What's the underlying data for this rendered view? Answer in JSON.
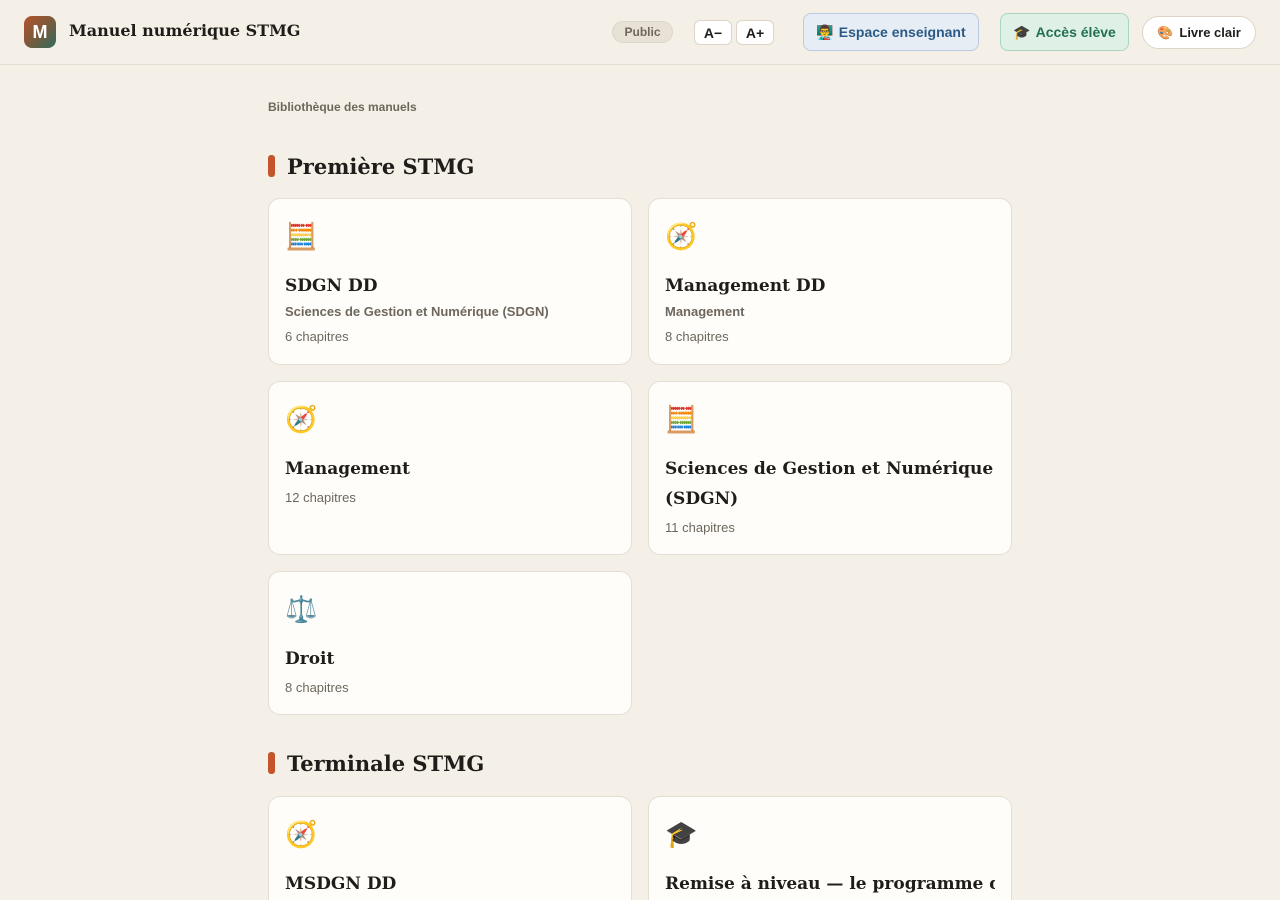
{
  "header": {
    "logo_letter": "M",
    "app_title": "Manuel numérique STMG",
    "visibility_badge": "Public",
    "font_decrease": "A−",
    "font_increase": "A+",
    "teacher_button": {
      "icon": "👨‍🏫",
      "label": "Espace enseignant"
    },
    "student_button": {
      "icon": "🎓",
      "label": "Accès élève"
    },
    "theme_button": {
      "icon": "🎨",
      "label": "Livre clair"
    }
  },
  "breadcrumb": "Bibliothèque des manuels",
  "sections": [
    {
      "title": "Première STMG",
      "cards": [
        {
          "icon": "🧮",
          "icon_name": "abacus-icon",
          "title": "SDGN DD",
          "subtitle": "Sciences de Gestion et Numérique (SDGN)",
          "meta": "6 chapitres"
        },
        {
          "icon": "🧭",
          "icon_name": "compass-icon",
          "title": "Management DD",
          "subtitle": "Management",
          "meta": "8 chapitres"
        },
        {
          "icon": "🧭",
          "icon_name": "compass-icon",
          "title": "Management",
          "subtitle": "",
          "meta": "12 chapitres"
        },
        {
          "icon": "🧮",
          "icon_name": "abacus-icon",
          "title": "Sciences de Gestion et Numérique (SDGN)",
          "subtitle": "",
          "meta": "11 chapitres"
        },
        {
          "icon": "⚖️",
          "icon_name": "scales-icon",
          "title": "Droit",
          "subtitle": "",
          "meta": "8 chapitres"
        }
      ]
    },
    {
      "title": "Terminale STMG",
      "cards": [
        {
          "icon": "🧭",
          "icon_name": "compass-icon",
          "title": "MSDGN DD",
          "subtitle": "",
          "meta": ""
        },
        {
          "icon": "🎓",
          "icon_name": "graduation-cap-icon",
          "title": "Remise à niveau — le programme de",
          "subtitle": "",
          "meta": ""
        }
      ]
    }
  ],
  "colors": {
    "accent": "#c4552b",
    "background": "#f5f0e7",
    "card": "#fffdf9"
  }
}
